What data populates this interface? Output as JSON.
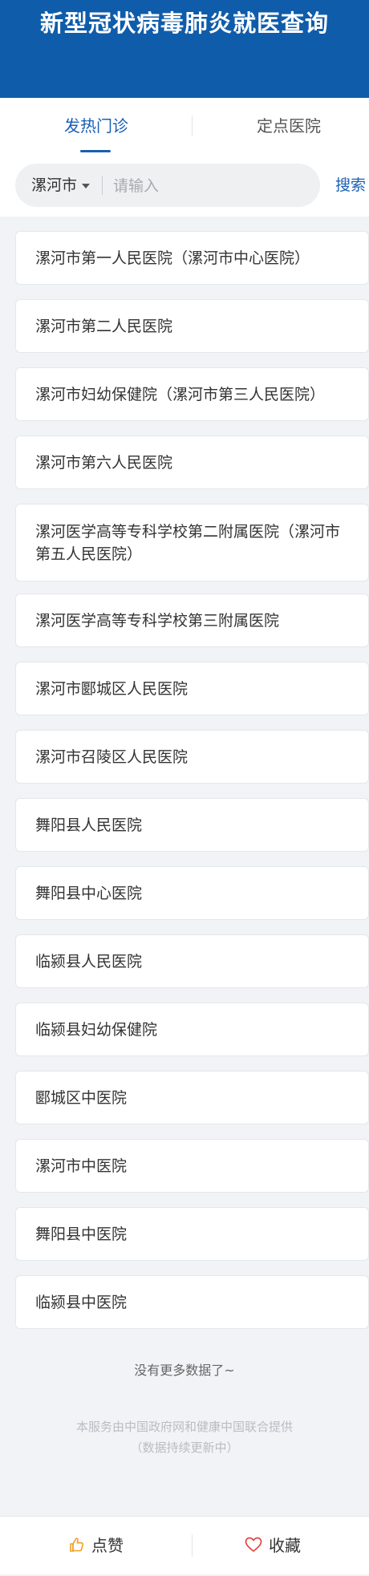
{
  "header": {
    "title": "新型冠状病毒肺炎就医查询"
  },
  "tabs": [
    {
      "label": "发热门诊",
      "active": true
    },
    {
      "label": "定点医院",
      "active": false
    }
  ],
  "search": {
    "city": "漯河市",
    "placeholder": "请输入",
    "button": "搜索"
  },
  "hospitals": [
    "漯河市第一人民医院（漯河市中心医院）",
    "漯河市第二人民医院",
    "漯河市妇幼保健院（漯河市第三人民医院）",
    "漯河市第六人民医院",
    "漯河医学高等专科学校第二附属医院（漯河市第五人民医院）",
    "漯河医学高等专科学校第三附属医院",
    "漯河市郾城区人民医院",
    "漯河市召陵区人民医院",
    "舞阳县人民医院",
    "舞阳县中心医院",
    "临颍县人民医院",
    "临颍县妇幼保健院",
    "郾城区中医院",
    "漯河市中医院",
    "舞阳县中医院",
    "临颍县中医院"
  ],
  "status": {
    "no_more": "没有更多数据了~"
  },
  "footer": {
    "line1": "本服务由中国政府网和健康中国联合提供",
    "line2": "（数据持续更新中）"
  },
  "bottom_bar": {
    "like_label": "点赞",
    "like_icon": "thumbs-up-icon",
    "favorite_label": "收藏",
    "favorite_icon": "heart-icon"
  },
  "colors": {
    "header_bg": "#0f5cab",
    "accent": "#1a5fb4",
    "page_bg": "#f1f3f6",
    "heart": "#e0443e",
    "thumb": "#f0a020"
  }
}
